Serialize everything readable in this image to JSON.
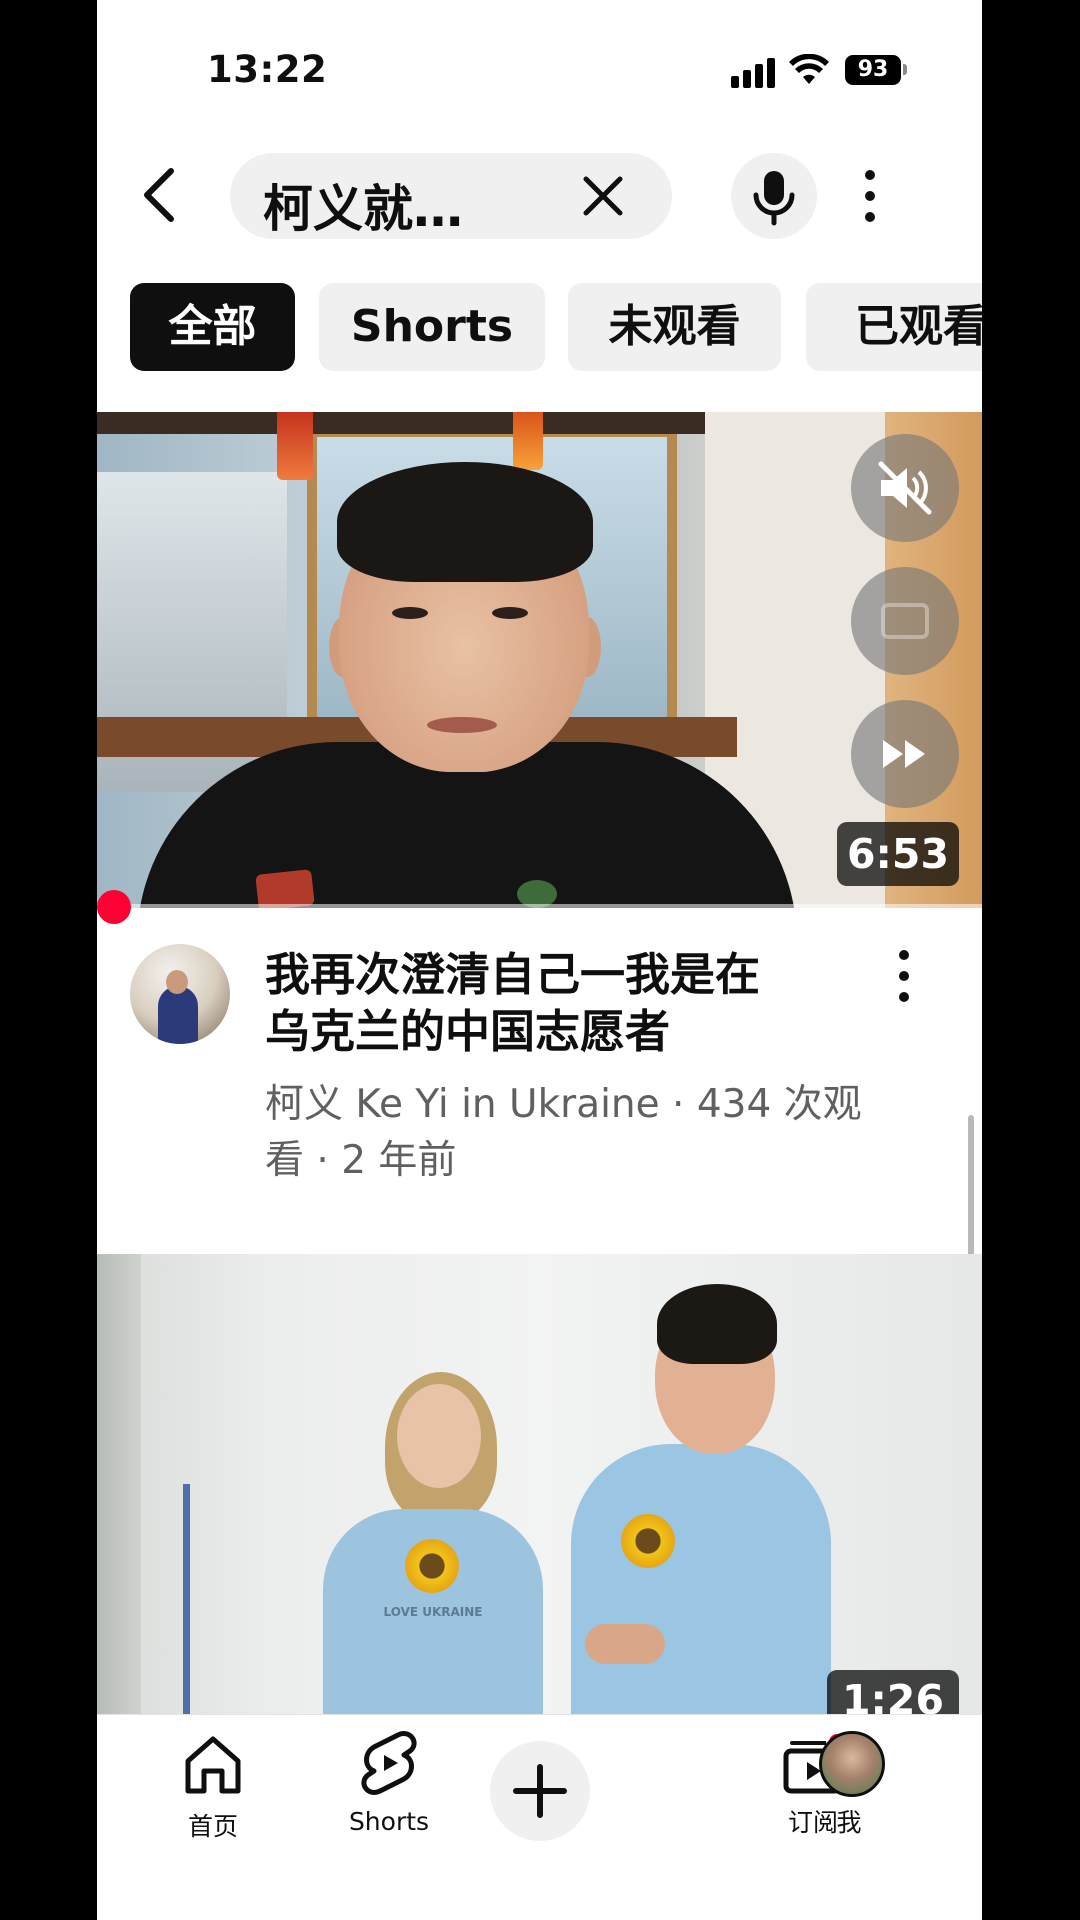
{
  "status_bar": {
    "time": "13:22",
    "battery": "93"
  },
  "search": {
    "query": "柯义就…"
  },
  "chips": [
    {
      "label": "全部",
      "active": true
    },
    {
      "label": "Shorts",
      "active": false
    },
    {
      "label": "未观看",
      "active": false
    },
    {
      "label": "已观看",
      "active": false
    }
  ],
  "videos": [
    {
      "duration": "6:53",
      "title": "我再次澄清自己一我是在乌克兰的中国志愿者",
      "meta": "柯义 Ke Yi in Ukraine · 434 次观看 · 2 年前",
      "progress_fraction": 0.0
    },
    {
      "duration": "1:26",
      "shirt_text": "LOVE UKRAINE"
    }
  ],
  "bottom_nav": [
    {
      "label": "首页",
      "icon": "home-icon"
    },
    {
      "label": "Shorts",
      "icon": "shorts-icon"
    },
    {
      "label": "",
      "icon": "plus-icon"
    },
    {
      "label": "订阅",
      "icon": "subscriptions-icon"
    },
    {
      "label": "我",
      "icon": "avatar-icon"
    }
  ],
  "colors": {
    "accent": "#ff0033",
    "text_primary": "#0f0f0f",
    "text_secondary": "#606060",
    "chip_bg": "#f0f0f0"
  }
}
